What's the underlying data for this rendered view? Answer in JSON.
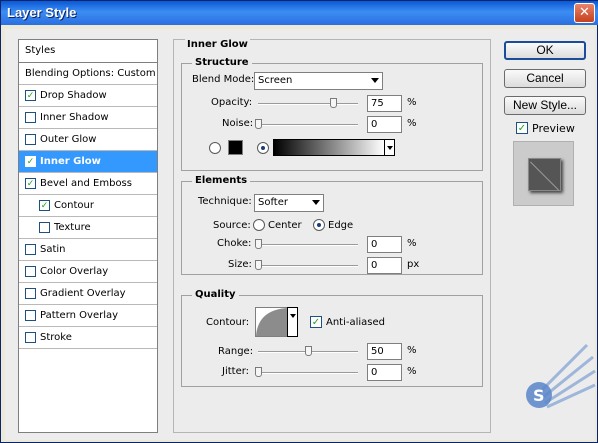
{
  "window": {
    "title": "Layer Style",
    "close_label": "✕"
  },
  "styles_panel": {
    "header": "Styles",
    "items": [
      {
        "label": "Blending Options: Custom",
        "has_checkbox": false,
        "checked": false,
        "selected": false,
        "sub": false
      },
      {
        "label": "Drop Shadow",
        "has_checkbox": true,
        "checked": true,
        "selected": false,
        "sub": false
      },
      {
        "label": "Inner Shadow",
        "has_checkbox": true,
        "checked": false,
        "selected": false,
        "sub": false
      },
      {
        "label": "Outer Glow",
        "has_checkbox": true,
        "checked": false,
        "selected": false,
        "sub": false
      },
      {
        "label": "Inner Glow",
        "has_checkbox": true,
        "checked": true,
        "selected": true,
        "sub": false
      },
      {
        "label": "Bevel and Emboss",
        "has_checkbox": true,
        "checked": true,
        "selected": false,
        "sub": false
      },
      {
        "label": "Contour",
        "has_checkbox": true,
        "checked": true,
        "selected": false,
        "sub": true
      },
      {
        "label": "Texture",
        "has_checkbox": true,
        "checked": false,
        "selected": false,
        "sub": true
      },
      {
        "label": "Satin",
        "has_checkbox": true,
        "checked": false,
        "selected": false,
        "sub": false
      },
      {
        "label": "Color Overlay",
        "has_checkbox": true,
        "checked": false,
        "selected": false,
        "sub": false
      },
      {
        "label": "Gradient Overlay",
        "has_checkbox": true,
        "checked": false,
        "selected": false,
        "sub": false
      },
      {
        "label": "Pattern Overlay",
        "has_checkbox": true,
        "checked": false,
        "selected": false,
        "sub": false
      },
      {
        "label": "Stroke",
        "has_checkbox": true,
        "checked": false,
        "selected": false,
        "sub": false
      }
    ]
  },
  "inner_glow": {
    "title": "Inner Glow",
    "structure": {
      "title": "Structure",
      "blend_mode_label": "Blend Mode:",
      "blend_mode_value": "Screen",
      "opacity_label": "Opacity:",
      "opacity_value": "75",
      "opacity_unit": "%",
      "opacity_level": 0.75,
      "noise_label": "Noise:",
      "noise_value": "0",
      "noise_unit": "%",
      "noise_level": 0,
      "color_mode": "gradient"
    },
    "elements": {
      "title": "Elements",
      "technique_label": "Technique:",
      "technique_value": "Softer",
      "source_label": "Source:",
      "source_center_label": "Center",
      "source_edge_label": "Edge",
      "source_selected": "edge",
      "choke_label": "Choke:",
      "choke_value": "0",
      "choke_unit": "%",
      "size_label": "Size:",
      "size_value": "0",
      "size_unit": "px"
    },
    "quality": {
      "title": "Quality",
      "contour_label": "Contour:",
      "anti_aliased_label": "Anti-aliased",
      "anti_aliased_checked": true,
      "range_label": "Range:",
      "range_value": "50",
      "range_unit": "%",
      "range_level": 0.5,
      "jitter_label": "Jitter:",
      "jitter_value": "0",
      "jitter_unit": "%"
    }
  },
  "buttons": {
    "ok_label": "OK",
    "cancel_label": "Cancel",
    "new_style_label": "New Style...",
    "preview_label": "Preview",
    "preview_checked": true
  }
}
